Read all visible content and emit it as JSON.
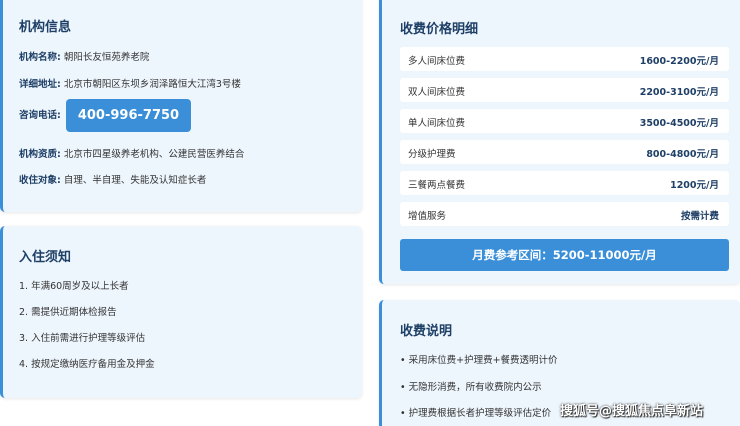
{
  "org": {
    "title": "机构信息",
    "name_key": "机构名称:",
    "name_val": "朝阳长友恒苑养老院",
    "addr_key": "详细地址:",
    "addr_val": "北京市朝阳区东坝乡润泽路恒大江湾3号楼",
    "phone_key": "咨询电话:",
    "phone_val": "400-996-7750",
    "qual_key": "机构资质:",
    "qual_val": "北京市四星级养老机构、公建民营医养结合",
    "target_key": "收住对象:",
    "target_val": "自理、半自理、失能及认知症长者"
  },
  "notes": {
    "title": "入住须知",
    "items": [
      "1. 年满60周岁及以上长者",
      "2. 需提供近期体检报告",
      "3. 入住前需进行护理等级评估",
      "4. 按规定缴纳医疗备用金及押金"
    ]
  },
  "prices": {
    "title": "收费价格明细",
    "rows": [
      {
        "name": "多人间床位费",
        "value": "1600-2200元/月"
      },
      {
        "name": "双人间床位费",
        "value": "2200-3100元/月"
      },
      {
        "name": "单人间床位费",
        "value": "3500-4500元/月"
      },
      {
        "name": "分级护理费",
        "value": "800-4800元/月"
      },
      {
        "name": "三餐两点餐费",
        "value": "1200元/月"
      },
      {
        "name": "增值服务",
        "value": "按需计费"
      }
    ],
    "range": "月费参考区间：5200-11000元/月"
  },
  "fees": {
    "title": "收费说明",
    "items": [
      "• 采用床位费+护理费+餐费透明计价",
      "• 无隐形消费，所有收费院内公示",
      "• 护理费根据长者护理等级评估定价"
    ]
  },
  "watermark": "搜狐号@搜狐焦点阜新站"
}
